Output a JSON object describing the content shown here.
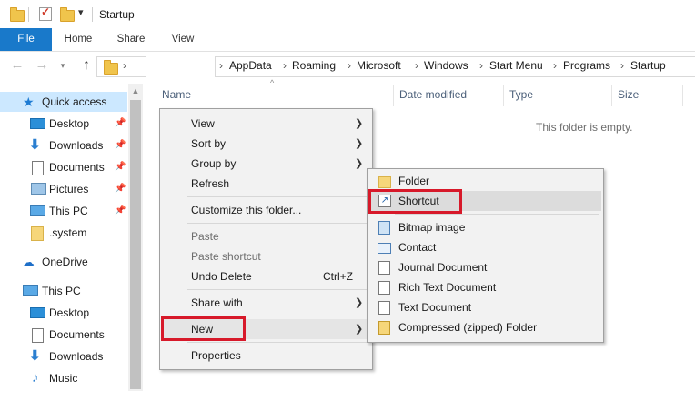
{
  "window": {
    "title": "Startup"
  },
  "ribbon": {
    "tabs": [
      "File",
      "Home",
      "Share",
      "View"
    ]
  },
  "address": {
    "path": [
      "AppData",
      "Roaming",
      "Microsoft",
      "Windows",
      "Start Menu",
      "Programs",
      "Startup"
    ]
  },
  "sidebar": {
    "items": [
      {
        "label": "Quick access",
        "icon": "star-icon",
        "pinned": false,
        "selected": true
      },
      {
        "label": "Desktop",
        "icon": "desktop-icon",
        "pinned": true
      },
      {
        "label": "Downloads",
        "icon": "download-arrow-icon",
        "pinned": true
      },
      {
        "label": "Documents",
        "icon": "documents-icon",
        "pinned": true
      },
      {
        "label": "Pictures",
        "icon": "pictures-icon",
        "pinned": true
      },
      {
        "label": "This PC",
        "icon": "computer-icon",
        "pinned": true
      },
      {
        "label": ".system",
        "icon": "folder-icon",
        "pinned": false
      },
      {
        "label": "OneDrive",
        "icon": "cloud-icon",
        "pinned": false
      },
      {
        "label": "This PC",
        "icon": "computer-icon",
        "pinned": false
      },
      {
        "label": "Desktop",
        "icon": "desktop-icon",
        "pinned": false
      },
      {
        "label": "Documents",
        "icon": "documents-icon",
        "pinned": false
      },
      {
        "label": "Downloads",
        "icon": "download-arrow-icon",
        "pinned": false
      },
      {
        "label": "Music",
        "icon": "music-note-icon",
        "pinned": false
      }
    ]
  },
  "columns": [
    "Name",
    "Date modified",
    "Type",
    "Size"
  ],
  "empty_message": "This folder is empty.",
  "context_menu": {
    "items": [
      {
        "label": "View",
        "submenu": true
      },
      {
        "label": "Sort by",
        "submenu": true
      },
      {
        "label": "Group by",
        "submenu": true
      },
      {
        "label": "Refresh"
      },
      {
        "label": "Customize this folder..."
      },
      {
        "label": "Paste",
        "disabled": true
      },
      {
        "label": "Paste shortcut",
        "disabled": true
      },
      {
        "label": "Undo Delete",
        "shortcut": "Ctrl+Z"
      },
      {
        "label": "Share with",
        "submenu": true
      },
      {
        "label": "New",
        "submenu": true,
        "highlighted": true
      },
      {
        "label": "Properties"
      }
    ]
  },
  "new_submenu": {
    "items": [
      {
        "label": "Folder",
        "icon": "folder-icon"
      },
      {
        "label": "Shortcut",
        "icon": "shortcut-icon",
        "highlighted": true
      },
      {
        "label": "Bitmap image",
        "icon": "bitmap-icon"
      },
      {
        "label": "Contact",
        "icon": "contact-card-icon"
      },
      {
        "label": "Journal Document",
        "icon": "journal-icon"
      },
      {
        "label": "Rich Text Document",
        "icon": "rich-text-icon"
      },
      {
        "label": "Text Document",
        "icon": "text-document-icon"
      },
      {
        "label": "Compressed (zipped) Folder",
        "icon": "zip-folder-icon"
      }
    ]
  },
  "colors": {
    "accent": "#1979ca",
    "selection": "#cce8ff",
    "highlight_box": "#d7192a",
    "menu_bg": "#f2f2f2"
  }
}
